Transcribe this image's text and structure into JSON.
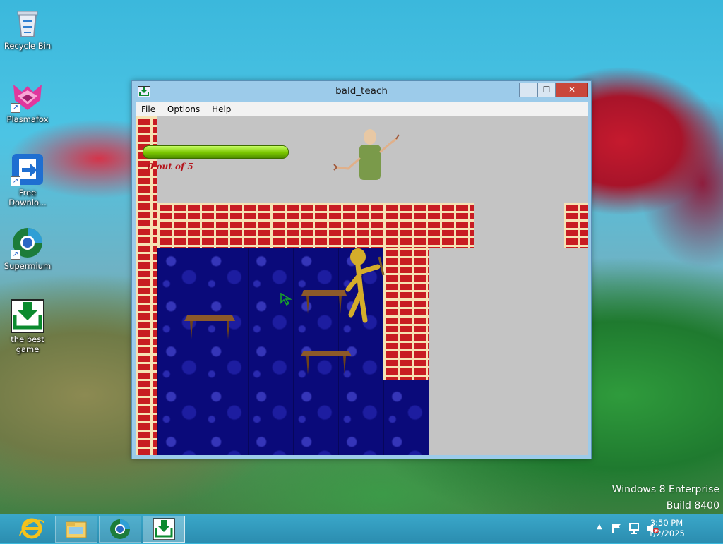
{
  "desktop": {
    "icons": [
      {
        "label": "Recycle Bin"
      },
      {
        "label": "Plasmafox"
      },
      {
        "label": "Free Downlo..."
      },
      {
        "label": "Supermium"
      },
      {
        "label": "the best game"
      }
    ]
  },
  "window": {
    "title": "bald_teach",
    "controls": {
      "minimize": "—",
      "maximize": "☐",
      "close": "✕"
    },
    "menu": [
      "File",
      "Options",
      "Help"
    ]
  },
  "game": {
    "stamina_fraction": 1.0,
    "notebook_counter": "0 out of 5",
    "colors": {
      "brick": "#c81c22",
      "mortar": "#f6e2b4",
      "floor": "#0a0a7a",
      "stamina": "#7ac600"
    }
  },
  "taskbar": {
    "buttons": [
      "internet-explorer-icon",
      "file-explorer-icon",
      "supermium-icon",
      "the-best-game-icon"
    ],
    "tray_icons": [
      "show-hidden-icons",
      "action-center-flag-icon",
      "network-icon",
      "volume-muted-icon"
    ],
    "time": "3:50 PM",
    "date": "1/2/2025"
  },
  "watermark": {
    "line1": "Windows 8 Enterprise",
    "line2": "Build 8400"
  }
}
